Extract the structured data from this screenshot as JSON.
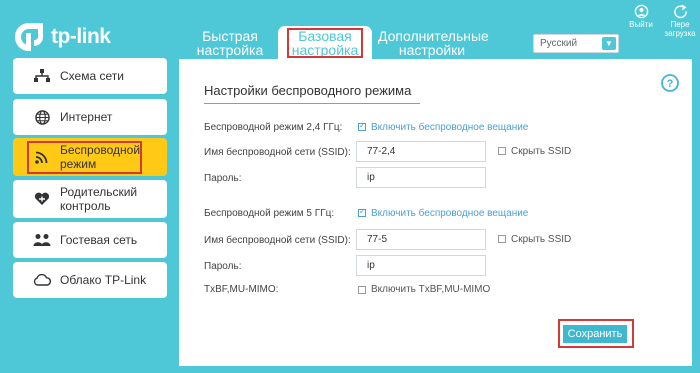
{
  "header": {
    "brand": "tp-link",
    "tabs": {
      "quick": [
        "Быстрая",
        "настройка"
      ],
      "basic": [
        "Базовая",
        "настройка"
      ],
      "advanced": [
        "Дополнительные",
        "настройки"
      ]
    },
    "language": "Русский",
    "logout": "Выйти",
    "reboot": [
      "Пере",
      "загрузка"
    ]
  },
  "sidebar": {
    "items": [
      {
        "label": "Схема сети",
        "icon": "network-map-icon"
      },
      {
        "label": "Интернет",
        "icon": "globe-icon"
      },
      {
        "label": "Беспроводной режим",
        "icon": "wifi-icon",
        "active": true
      },
      {
        "label": "Родительский контроль",
        "icon": "heart-icon"
      },
      {
        "label": "Гостевая сеть",
        "icon": "guests-icon"
      },
      {
        "label": "Облако TP-Link",
        "icon": "cloud-icon"
      }
    ]
  },
  "main": {
    "title": "Настройки беспроводного режима",
    "band24": {
      "label": "Беспроводной режим 2,4 ГГц:",
      "enable_label": "Включить беспроводное вещание",
      "enabled": true,
      "ssid_label": "Имя беспроводной сети (SSID):",
      "ssid": "77-2,4",
      "hide_label": "Скрыть SSID",
      "password_label": "Пароль:",
      "password": "ip"
    },
    "band5": {
      "label": "Беспроводной режим 5 ГГц:",
      "enable_label": "Включить беспроводное вещание",
      "enabled": true,
      "ssid_label": "Имя беспроводной сети (SSID):",
      "ssid": "77-5",
      "hide_label": "Скрыть SSID",
      "password_label": "Пароль:",
      "password": "ip"
    },
    "mimo_label": "TxBF,MU-MIMO:",
    "mimo_option": "Включить TxBF,MU-MIMO",
    "save": "Сохранить"
  },
  "colors": {
    "background": "#4ec8d6",
    "active_nav": "#ffc916",
    "highlight": "#d23a3a",
    "link": "#4a9fd6"
  }
}
